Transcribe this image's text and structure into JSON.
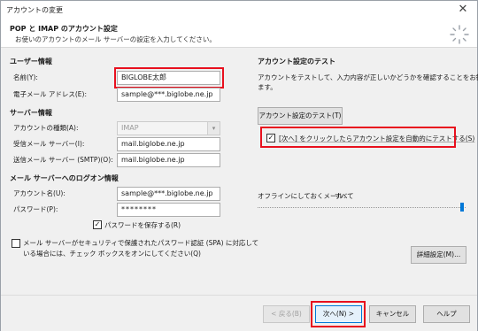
{
  "window": {
    "title": "アカウントの変更"
  },
  "header": {
    "title": "POP と IMAP のアカウント設定",
    "subtitle": "お使いのアカウントのメール サーバーの設定を入力してください。"
  },
  "user_info": {
    "heading": "ユーザー情報",
    "name_label": "名前(Y):",
    "name_value": "BIGLOBE太郎",
    "email_label": "電子メール アドレス(E):",
    "email_value": "sample@***.biglobe.ne.jp"
  },
  "server_info": {
    "heading": "サーバー情報",
    "account_type_label": "アカウントの種類(A):",
    "account_type_value": "IMAP",
    "incoming_label": "受信メール サーバー(I):",
    "incoming_value": "mail.biglobe.ne.jp",
    "outgoing_label": "送信メール サーバー (SMTP)(O):",
    "outgoing_value": "mail.biglobe.ne.jp"
  },
  "logon_info": {
    "heading": "メール サーバーへのログオン情報",
    "account_label": "アカウント名(U):",
    "account_value": "sample@***.biglobe.ne.jp",
    "password_label": "パスワード(P):",
    "password_value": "********",
    "remember_password": "パスワードを保存する(R)",
    "spa_line1": "メール サーバーがセキュリティで保護されたパスワード認証 (SPA) に対応して",
    "spa_line2": "いる場合には、チェック ボックスをオンにしてください(Q)"
  },
  "test": {
    "heading": "アカウント設定のテスト",
    "desc_line1": "アカウントをテストして、入力内容が正しいかどうかを確認することをお勧めし",
    "desc_line2": "ます。",
    "test_button": "アカウント設定のテスト(T)",
    "auto_test": "[次へ] をクリックしたらアカウント設定を自動的にテストする(S)"
  },
  "offline": {
    "label": "オフラインにしておくメール:",
    "value": "すべて",
    "level": 1.0
  },
  "advanced_button": "詳細設定(M)...",
  "footer": {
    "back": "< 戻る(B)",
    "next": "次へ(N) >",
    "cancel": "キャンセル",
    "help": "ヘルプ"
  },
  "icons": {
    "close": "close-icon",
    "spinner": "spinner-icon",
    "combo": "chevron-down-icon",
    "check": "check-icon"
  },
  "colors": {
    "highlight": "#e8101e",
    "accent": "#0078d7",
    "panel": "#f0f0f0"
  }
}
